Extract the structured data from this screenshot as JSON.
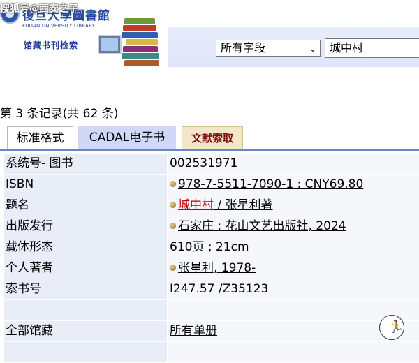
{
  "header": {
    "watermark": "搜狐号@西安之子",
    "library_name_cn": "復旦大學圖書館",
    "library_name_en": "FUDAN UNIVERSITY LIBRARY",
    "catalog_title": "馆藏书刊检索"
  },
  "search": {
    "field_selected": "所有字段",
    "query_value": "城中村"
  },
  "results": {
    "record_count": "第 3 条记录(共 62 条)"
  },
  "tabs": [
    {
      "label": "标准格式"
    },
    {
      "label": "CADAL电子书"
    },
    {
      "label": "文献索取"
    }
  ],
  "record": {
    "rows": [
      {
        "label": "系统号- 图书",
        "value": "002531971"
      },
      {
        "label": "ISBN",
        "value": "978-7-5511-7090-1 : CNY69.80"
      },
      {
        "label": "题名",
        "value_red": "城中村",
        "value": " / 张星利著"
      },
      {
        "label": "出版发行",
        "value": "石家庄 : 花山文艺出版社, 2024"
      },
      {
        "label": "载体形态",
        "value": "610页 ; 21cm"
      },
      {
        "label": "个人著者",
        "value": "张星利, 1978-"
      },
      {
        "label": "索书号",
        "value": "I247.57 /Z35123"
      },
      {
        "label": "",
        "value": ""
      },
      {
        "label": "全部馆藏",
        "value": "所有单册"
      },
      {
        "label": "",
        "value": ""
      }
    ]
  },
  "colors": {
    "label_bg": "#e9edf8",
    "tab_active_line": "#6b84c4",
    "title_link": "#c00000"
  }
}
